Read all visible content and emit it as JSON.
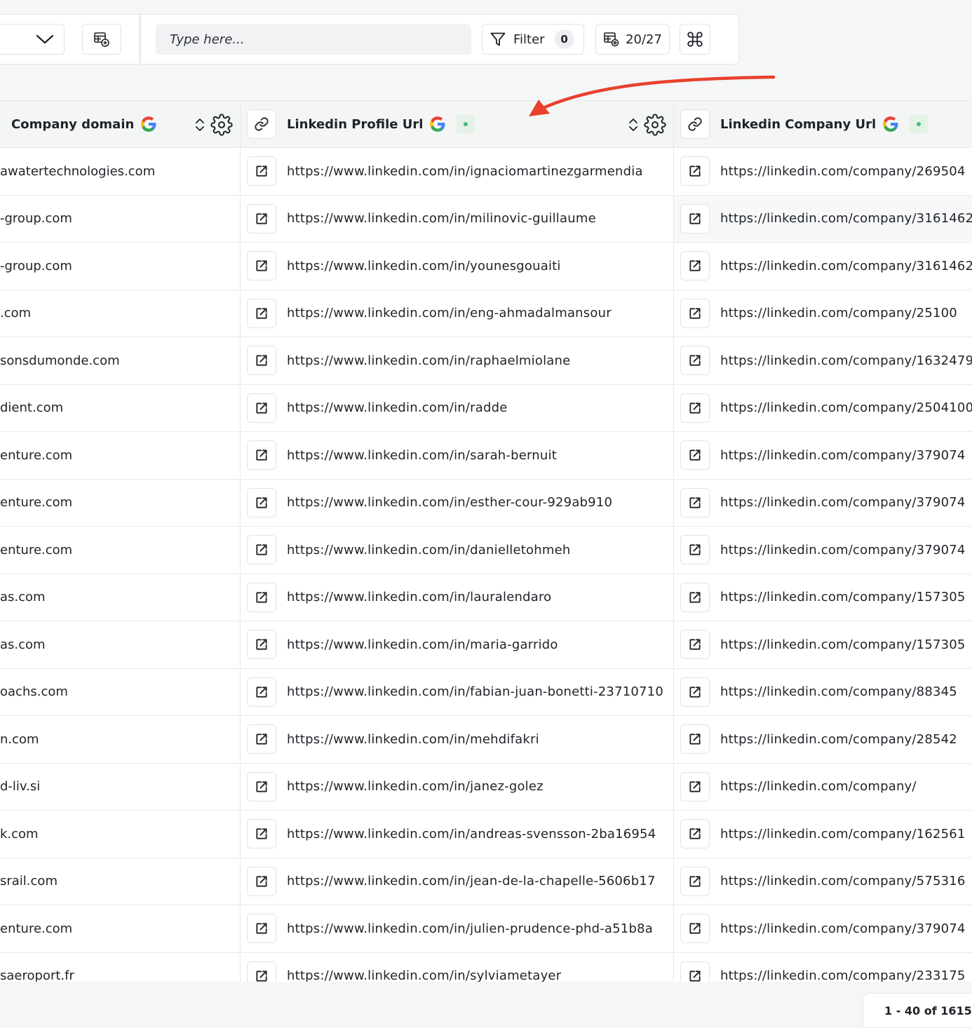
{
  "toolbar": {
    "search_placeholder": "Type here...",
    "filter_label": "Filter",
    "filter_count": "0",
    "columns_count": "20/27"
  },
  "columns": [
    {
      "title": "Company domain"
    },
    {
      "title": "Linkedin Profile Url"
    },
    {
      "title": "Linkedin Company Url"
    }
  ],
  "rows": [
    {
      "domain": "awatertechnologies.com",
      "profile": "https://www.linkedin.com/in/ignaciomartinezgarmendia",
      "company": "https://linkedin.com/company/269504"
    },
    {
      "domain": "-group.com",
      "profile": "https://www.linkedin.com/in/milinovic-guillaume",
      "company": "https://linkedin.com/company/3161462"
    },
    {
      "domain": "-group.com",
      "profile": "https://www.linkedin.com/in/younesgouaiti",
      "company": "https://linkedin.com/company/3161462"
    },
    {
      "domain": ".com",
      "profile": "https://www.linkedin.com/in/eng-ahmadalmansour",
      "company": "https://linkedin.com/company/25100"
    },
    {
      "domain": "sonsdumonde.com",
      "profile": "https://www.linkedin.com/in/raphaelmiolane",
      "company": "https://linkedin.com/company/1632479"
    },
    {
      "domain": "dient.com",
      "profile": "https://www.linkedin.com/in/radde",
      "company": "https://linkedin.com/company/2504100"
    },
    {
      "domain": "enture.com",
      "profile": "https://www.linkedin.com/in/sarah-bernuit",
      "company": "https://linkedin.com/company/379074"
    },
    {
      "domain": "enture.com",
      "profile": "https://www.linkedin.com/in/esther-cour-929ab910",
      "company": "https://linkedin.com/company/379074"
    },
    {
      "domain": "enture.com",
      "profile": "https://www.linkedin.com/in/danielletohmeh",
      "company": "https://linkedin.com/company/379074"
    },
    {
      "domain": "as.com",
      "profile": "https://www.linkedin.com/in/lauralendaro",
      "company": "https://linkedin.com/company/157305"
    },
    {
      "domain": "as.com",
      "profile": "https://www.linkedin.com/in/maria-garrido",
      "company": "https://linkedin.com/company/157305"
    },
    {
      "domain": "oachs.com",
      "profile": "https://www.linkedin.com/in/fabian-juan-bonetti-23710710",
      "company": "https://linkedin.com/company/88345"
    },
    {
      "domain": "n.com",
      "profile": "https://www.linkedin.com/in/mehdifakri",
      "company": "https://linkedin.com/company/28542"
    },
    {
      "domain": "d-liv.si",
      "profile": "https://www.linkedin.com/in/janez-golez",
      "company": "https://linkedin.com/company/"
    },
    {
      "domain": "k.com",
      "profile": "https://www.linkedin.com/in/andreas-svensson-2ba16954",
      "company": "https://linkedin.com/company/162561"
    },
    {
      "domain": "srail.com",
      "profile": "https://www.linkedin.com/in/jean-de-la-chapelle-5606b17",
      "company": "https://linkedin.com/company/575316"
    },
    {
      "domain": "enture.com",
      "profile": "https://www.linkedin.com/in/julien-prudence-phd-a51b8a",
      "company": "https://linkedin.com/company/379074"
    },
    {
      "domain": "saeroport.fr",
      "profile": "https://www.linkedin.com/in/sylviametayer",
      "company": "https://linkedin.com/company/233175"
    }
  ],
  "pagination": {
    "label": "1 - 40 of 1615"
  },
  "colors": {
    "accent_arrow": "#e8412c",
    "status_green": "#48bb78",
    "header_bg": "#f3f6f5"
  }
}
